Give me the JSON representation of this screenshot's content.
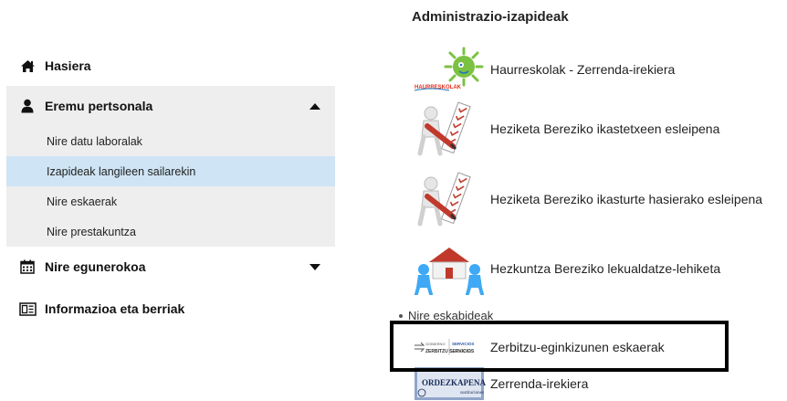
{
  "sidebar": {
    "items": [
      {
        "label": "Hasiera",
        "icon": "home-icon"
      },
      {
        "label": "Eremu pertsonala",
        "icon": "user-icon",
        "expanded": true,
        "children": [
          {
            "label": "Nire datu laboralak"
          },
          {
            "label": "Izapideak langileen sailarekin",
            "active": true
          },
          {
            "label": "Nire eskaerak"
          },
          {
            "label": "Nire prestakuntza"
          }
        ]
      },
      {
        "label": "Nire egunerokoa",
        "icon": "calendar-icon",
        "expanded": false
      },
      {
        "label": "Informazioa eta berriak",
        "icon": "newspaper-icon"
      }
    ]
  },
  "main": {
    "title": "Administrazio-izapideak",
    "procedures": [
      {
        "label": "Haurreskolak - Zerrenda-irekiera",
        "icon": "haurreskolak-logo",
        "logo_text": "HAURRESKOLAK"
      },
      {
        "label": "Heziketa Bereziko ikastetxeen esleipena",
        "icon": "checklist-figure-icon"
      },
      {
        "label": "Heziketa Bereziko ikasturte hasierako esleipena",
        "icon": "checklist-figure-icon"
      },
      {
        "label": "Hezkuntza Bereziko lekualdatze-lehiketa",
        "icon": "moving-house-icon"
      }
    ],
    "sub_section": {
      "label": "Nire eskabideak",
      "items": [
        {
          "label": "Zerbitzu-eginkizunen eskaerak",
          "icon": "zerbitzu-logo",
          "logo_text": "ZERBITZU SERVICIOS"
        },
        {
          "label": "Zerrenda-irekiera",
          "icon": "ordezkapenak-logo",
          "logo_text": "ORDEZKAPENAK"
        }
      ]
    }
  },
  "colors": {
    "active_bg": "#cfe4f4",
    "section_bg": "#eeeeee",
    "highlight_border": "#000000"
  }
}
